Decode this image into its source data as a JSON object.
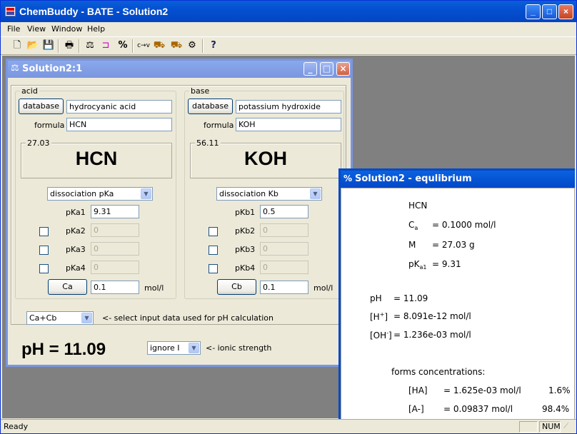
{
  "app": {
    "title": "ChemBuddy - BATE - Solution2"
  },
  "menu": [
    "File",
    "View",
    "Window",
    "Help"
  ],
  "status": {
    "text": "Ready",
    "num": "NUM"
  },
  "child1": {
    "title": "Solution2:1",
    "acid": {
      "group": "acid",
      "db_button": "database",
      "name": "hydrocyanic acid",
      "formula_label": "formula",
      "formula": "HCN",
      "mass": "27.03",
      "big": "HCN",
      "mode": "dissociation pKa",
      "k1_label": "pKa1",
      "k1": "9.31",
      "k2_label": "pKa2",
      "k2": "0",
      "k3_label": "pKa3",
      "k3": "0",
      "k4_label": "pKa4",
      "k4": "0",
      "conc_button": "Ca",
      "conc": "0.1",
      "unit": "mol/l"
    },
    "base": {
      "group": "base",
      "db_button": "database",
      "name": "potassium hydroxide",
      "formula_label": "formula",
      "formula": "KOH",
      "mass": "56.11",
      "big": "KOH",
      "mode": "dissociation Kb",
      "k1_label": "pKb1",
      "k1": "0.5",
      "k2_label": "pKb2",
      "k2": "0",
      "k3_label": "pKb3",
      "k3": "0",
      "k4_label": "pKb4",
      "k4": "0",
      "conc_button": "Cb",
      "conc": "0.1",
      "unit": "mol/l"
    },
    "input_select": "Ca+Cb",
    "input_hint": "<- select input data used for pH calculation",
    "ph_big": "pH = 11.09",
    "ionic_select": "ignore I",
    "ionic_hint": "<- ionic strength"
  },
  "child2": {
    "title": "Solution2 - equlibrium",
    "acid": "HCN",
    "ca_label": "C",
    "ca_sub": "a",
    "ca_val": "= 0.1000 mol/l",
    "m_label": "M",
    "m_val": "= 27.03 g",
    "pk_label": "pK",
    "pk_sub": "a1",
    "pk_val": "= 9.31",
    "ph_label": "pH",
    "ph_val": "= 11.09",
    "h_label": "[H",
    "h_sup": "+",
    "h_close": "]",
    "h_val": "= 8.091e-12 mol/l",
    "oh_label": "[OH",
    "oh_sup": "-",
    "oh_close": "]",
    "oh_val": "= 1.236e-03 mol/l",
    "forms_title": "forms concentrations:",
    "forms": [
      {
        "label": "[HA]",
        "val": "= 1.625e-03 mol/l",
        "pct": "1.6%"
      },
      {
        "label": "[A-]",
        "val": "= 0.09837 mol/l",
        "pct": "98.4%"
      }
    ]
  }
}
